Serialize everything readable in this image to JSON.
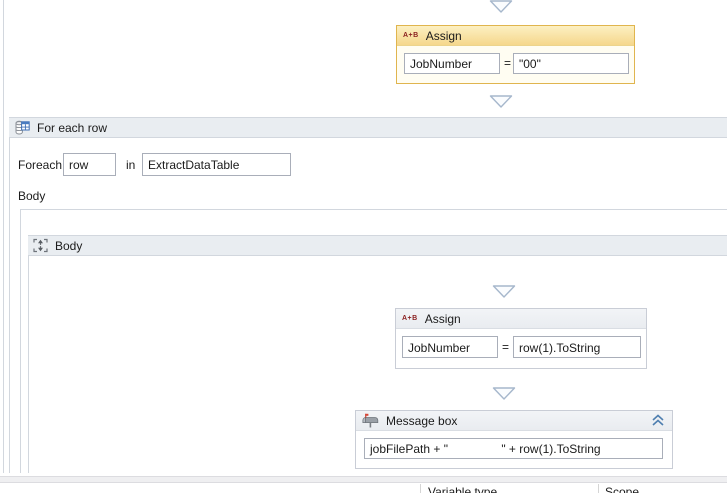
{
  "activities": {
    "assign1": {
      "title": "Assign",
      "icon_text": "A+B",
      "to": "JobNumber",
      "equals": "=",
      "value": "\"00\""
    },
    "foreach": {
      "title": "For each row",
      "foreach_label": "Foreach",
      "item_variable": "row",
      "in_label": "in",
      "collection": "ExtractDataTable",
      "body_label": "Body"
    },
    "body_sequence": {
      "title": "Body"
    },
    "assign2": {
      "title": "Assign",
      "icon_text": "A+B",
      "to": "JobNumber",
      "equals": "=",
      "value": "row(1).ToString"
    },
    "messagebox": {
      "title": "Message box",
      "text": "jobFilePath + \"                \" + row(1).ToString"
    }
  },
  "bottom_panel": {
    "columns": {
      "variable_type": "Variable type",
      "scope": "Scope"
    }
  },
  "colors": {
    "--sel-border": "#e0b54e",
    "--sel-header-bot": "#f5d78c",
    "--cont-header": "#e9edf1",
    "--icon-red": "#8a1f1f",
    "--collapse-blue": "#4f7fb0",
    "--chev": "#a6b7cc"
  }
}
